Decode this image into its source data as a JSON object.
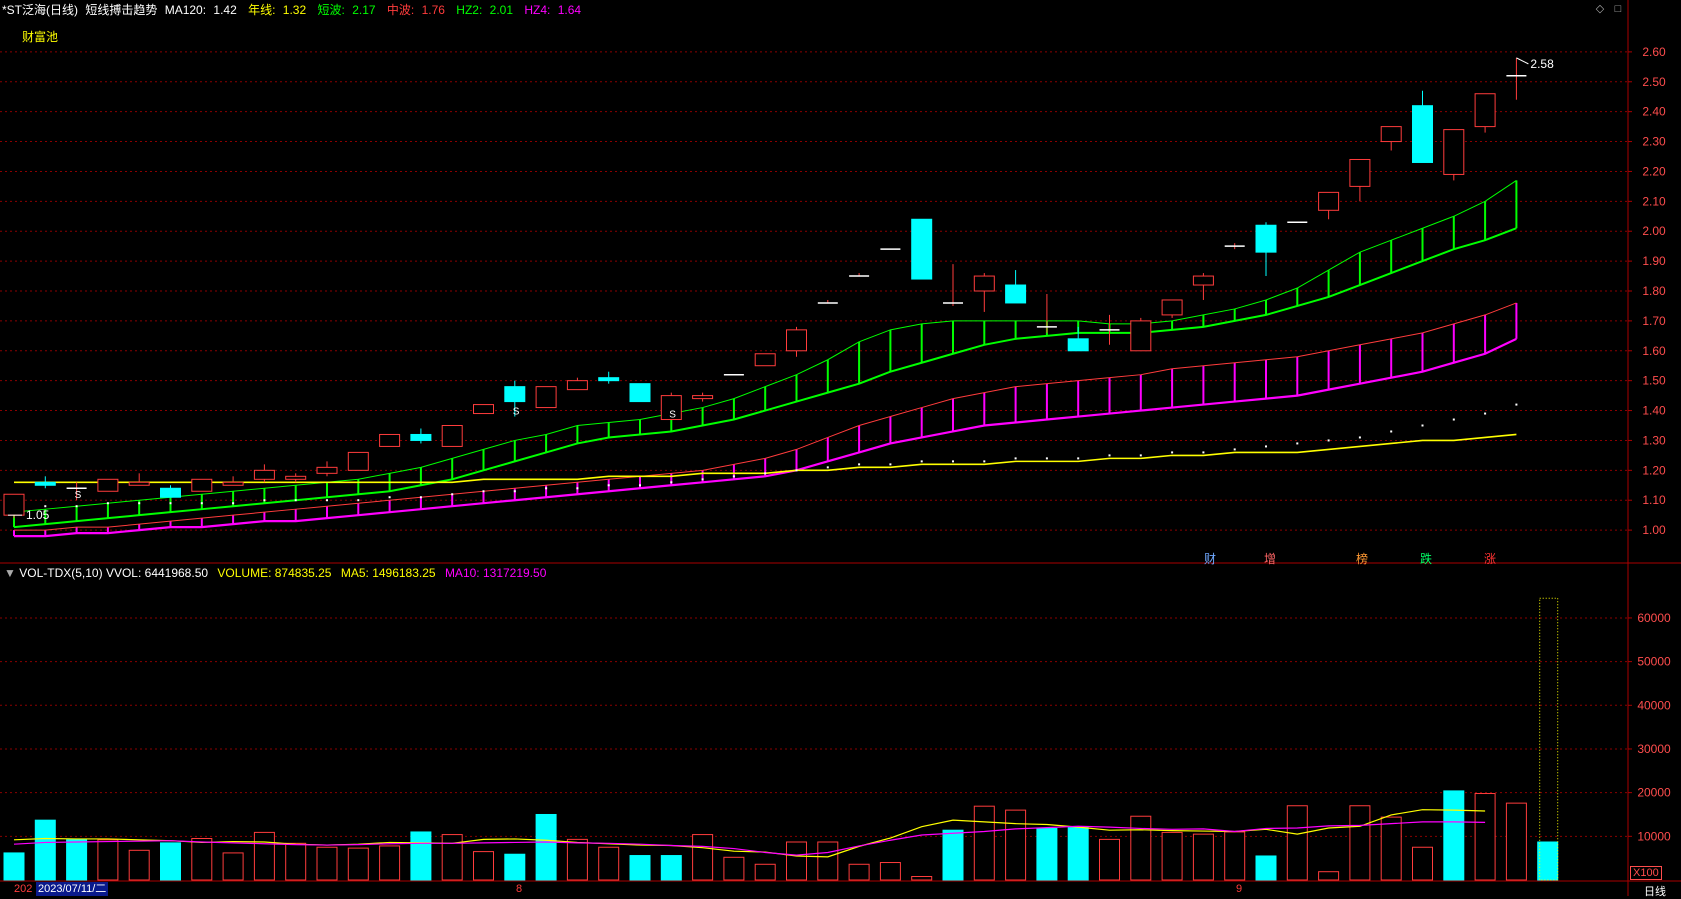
{
  "header": {
    "symbol": "*ST泛海(日线)",
    "indicator_name": "短线搏击趋势",
    "ma120_label": "MA120:",
    "ma120_value": "1.42",
    "year_label": "年线:",
    "year_value": "1.32",
    "short_label": "短波:",
    "short_value": "2.17",
    "mid_label": "中波:",
    "mid_value": "1.76",
    "hz2_label": "HZ2:",
    "hz2_value": "2.01",
    "hz4_label": "HZ4:",
    "hz4_value": "1.64",
    "pool_label": "财富池"
  },
  "volume_header": {
    "name": "VOL-TDX(5,10)",
    "vvol_label": "VVOL:",
    "vvol_value": "6441968.50",
    "volume_label": "VOLUME:",
    "volume_value": "874835.25",
    "ma5_label": "MA5:",
    "ma5_value": "1496183.25",
    "ma10_label": "MA10:",
    "ma10_value": "1317219.50"
  },
  "footer": {
    "date_prefix": "202",
    "date": "2023/07/11/二",
    "month_aug": "8",
    "month_sep": "9",
    "period": "日线",
    "scale": "X100"
  },
  "signals": [
    "财",
    "增",
    "榜",
    "跌",
    "涨"
  ],
  "annotations": {
    "high_label": "2.58",
    "low_label": "1.05",
    "marker_s": "S"
  },
  "colors": {
    "up": "#ff3c3c",
    "down": "#00ffff",
    "green_band": "#00ff00",
    "magenta_band": "#ff00ff",
    "yellow": "#ffff00",
    "grid": "#8b0000",
    "axis_text": "#ff4d4d"
  },
  "chart_data": [
    {
      "type": "candlestick",
      "title": "短线搏击趋势",
      "ylim": [
        0.9,
        2.7
      ],
      "yticks": [
        1.0,
        1.1,
        1.2,
        1.3,
        1.4,
        1.5,
        1.6,
        1.7,
        1.8,
        1.9,
        2.0,
        2.1,
        2.2,
        2.3,
        2.4,
        2.5,
        2.6
      ],
      "candles": [
        {
          "o": 1.05,
          "h": 1.12,
          "l": 1.04,
          "c": 1.12
        },
        {
          "o": 1.16,
          "h": 1.18,
          "l": 1.14,
          "c": 1.15
        },
        {
          "o": 1.14,
          "h": 1.16,
          "l": 1.1,
          "c": 1.14
        },
        {
          "o": 1.13,
          "h": 1.17,
          "l": 1.13,
          "c": 1.17
        },
        {
          "o": 1.15,
          "h": 1.19,
          "l": 1.15,
          "c": 1.16
        },
        {
          "o": 1.14,
          "h": 1.15,
          "l": 1.11,
          "c": 1.11
        },
        {
          "o": 1.13,
          "h": 1.17,
          "l": 1.13,
          "c": 1.17
        },
        {
          "o": 1.15,
          "h": 1.18,
          "l": 1.15,
          "c": 1.16
        },
        {
          "o": 1.17,
          "h": 1.22,
          "l": 1.16,
          "c": 1.2
        },
        {
          "o": 1.17,
          "h": 1.19,
          "l": 1.16,
          "c": 1.18
        },
        {
          "o": 1.19,
          "h": 1.23,
          "l": 1.18,
          "c": 1.21
        },
        {
          "o": 1.2,
          "h": 1.26,
          "l": 1.2,
          "c": 1.26
        },
        {
          "o": 1.28,
          "h": 1.32,
          "l": 1.28,
          "c": 1.32
        },
        {
          "o": 1.32,
          "h": 1.34,
          "l": 1.29,
          "c": 1.3
        },
        {
          "o": 1.28,
          "h": 1.35,
          "l": 1.28,
          "c": 1.35
        },
        {
          "o": 1.39,
          "h": 1.42,
          "l": 1.39,
          "c": 1.42
        },
        {
          "o": 1.48,
          "h": 1.5,
          "l": 1.38,
          "c": 1.43
        },
        {
          "o": 1.41,
          "h": 1.48,
          "l": 1.41,
          "c": 1.48
        },
        {
          "o": 1.47,
          "h": 1.51,
          "l": 1.47,
          "c": 1.5
        },
        {
          "o": 1.51,
          "h": 1.53,
          "l": 1.49,
          "c": 1.5
        },
        {
          "o": 1.49,
          "h": 1.49,
          "l": 1.43,
          "c": 1.43
        },
        {
          "o": 1.37,
          "h": 1.46,
          "l": 1.37,
          "c": 1.45
        },
        {
          "o": 1.44,
          "h": 1.46,
          "l": 1.43,
          "c": 1.45
        },
        {
          "o": 1.52,
          "h": 1.52,
          "l": 1.52,
          "c": 1.52
        },
        {
          "o": 1.55,
          "h": 1.59,
          "l": 1.55,
          "c": 1.59
        },
        {
          "o": 1.6,
          "h": 1.68,
          "l": 1.58,
          "c": 1.67
        },
        {
          "o": 1.76,
          "h": 1.77,
          "l": 1.76,
          "c": 1.76
        },
        {
          "o": 1.85,
          "h": 1.86,
          "l": 1.85,
          "c": 1.85
        },
        {
          "o": 1.94,
          "h": 1.94,
          "l": 1.94,
          "c": 1.94
        },
        {
          "o": 2.04,
          "h": 2.04,
          "l": 1.84,
          "c": 1.84
        },
        {
          "o": 1.76,
          "h": 1.89,
          "l": 1.75,
          "c": 1.76
        },
        {
          "o": 1.8,
          "h": 1.86,
          "l": 1.73,
          "c": 1.85
        },
        {
          "o": 1.82,
          "h": 1.87,
          "l": 1.76,
          "c": 1.76
        },
        {
          "o": 1.68,
          "h": 1.79,
          "l": 1.66,
          "c": 1.68
        },
        {
          "o": 1.64,
          "h": 1.68,
          "l": 1.6,
          "c": 1.6
        },
        {
          "o": 1.67,
          "h": 1.72,
          "l": 1.62,
          "c": 1.67
        },
        {
          "o": 1.6,
          "h": 1.71,
          "l": 1.6,
          "c": 1.7
        },
        {
          "o": 1.72,
          "h": 1.77,
          "l": 1.71,
          "c": 1.77
        },
        {
          "o": 1.82,
          "h": 1.86,
          "l": 1.77,
          "c": 1.85
        },
        {
          "o": 1.95,
          "h": 1.96,
          "l": 1.94,
          "c": 1.95
        },
        {
          "o": 2.02,
          "h": 2.03,
          "l": 1.85,
          "c": 1.93
        },
        {
          "o": 2.03,
          "h": 2.03,
          "l": 2.03,
          "c": 2.03
        },
        {
          "o": 2.07,
          "h": 2.13,
          "l": 2.04,
          "c": 2.13
        },
        {
          "o": 2.15,
          "h": 2.24,
          "l": 2.1,
          "c": 2.24
        },
        {
          "o": 2.3,
          "h": 2.35,
          "l": 2.27,
          "c": 2.35
        },
        {
          "o": 2.42,
          "h": 2.47,
          "l": 2.23,
          "c": 2.23
        },
        {
          "o": 2.19,
          "h": 2.34,
          "l": 2.17,
          "c": 2.34
        },
        {
          "o": 2.35,
          "h": 2.46,
          "l": 2.33,
          "c": 2.46
        },
        {
          "o": 2.52,
          "h": 2.58,
          "l": 2.44,
          "c": 2.52
        }
      ],
      "year_line": [
        1.16,
        1.16,
        1.16,
        1.16,
        1.16,
        1.16,
        1.16,
        1.16,
        1.16,
        1.16,
        1.16,
        1.16,
        1.16,
        1.16,
        1.16,
        1.17,
        1.17,
        1.17,
        1.17,
        1.18,
        1.18,
        1.18,
        1.19,
        1.19,
        1.19,
        1.2,
        1.2,
        1.21,
        1.21,
        1.22,
        1.22,
        1.22,
        1.23,
        1.23,
        1.23,
        1.24,
        1.24,
        1.25,
        1.25,
        1.26,
        1.26,
        1.26,
        1.27,
        1.28,
        1.29,
        1.3,
        1.3,
        1.31,
        1.32
      ],
      "ma120": [
        1.08,
        1.08,
        1.08,
        1.09,
        1.09,
        1.09,
        1.09,
        1.09,
        1.1,
        1.1,
        1.1,
        1.1,
        1.11,
        1.11,
        1.12,
        1.13,
        1.13,
        1.14,
        1.14,
        1.15,
        1.15,
        1.16,
        1.17,
        1.18,
        1.19,
        1.2,
        1.21,
        1.22,
        1.22,
        1.23,
        1.23,
        1.23,
        1.24,
        1.24,
        1.24,
        1.25,
        1.25,
        1.26,
        1.26,
        1.27,
        1.28,
        1.29,
        1.3,
        1.31,
        1.33,
        1.35,
        1.37,
        1.39,
        1.42
      ],
      "green_upper": [
        1.06,
        1.07,
        1.08,
        1.09,
        1.1,
        1.11,
        1.12,
        1.13,
        1.14,
        1.15,
        1.16,
        1.17,
        1.19,
        1.21,
        1.24,
        1.27,
        1.3,
        1.32,
        1.35,
        1.36,
        1.37,
        1.39,
        1.41,
        1.44,
        1.48,
        1.52,
        1.57,
        1.63,
        1.67,
        1.69,
        1.7,
        1.7,
        1.7,
        1.7,
        1.7,
        1.69,
        1.69,
        1.7,
        1.72,
        1.74,
        1.77,
        1.81,
        1.87,
        1.93,
        1.97,
        2.01,
        2.05,
        2.1,
        2.17
      ],
      "green_lower": [
        1.01,
        1.02,
        1.03,
        1.04,
        1.05,
        1.06,
        1.07,
        1.08,
        1.09,
        1.1,
        1.11,
        1.12,
        1.13,
        1.15,
        1.17,
        1.2,
        1.23,
        1.26,
        1.29,
        1.31,
        1.32,
        1.33,
        1.35,
        1.37,
        1.4,
        1.43,
        1.46,
        1.49,
        1.53,
        1.56,
        1.59,
        1.62,
        1.64,
        1.65,
        1.66,
        1.66,
        1.66,
        1.67,
        1.68,
        1.7,
        1.72,
        1.75,
        1.78,
        1.82,
        1.86,
        1.9,
        1.94,
        1.97,
        2.01
      ],
      "mag_upper": [
        1.0,
        1.0,
        1.01,
        1.01,
        1.02,
        1.03,
        1.04,
        1.05,
        1.06,
        1.07,
        1.08,
        1.09,
        1.1,
        1.11,
        1.12,
        1.13,
        1.14,
        1.15,
        1.16,
        1.17,
        1.18,
        1.19,
        1.2,
        1.22,
        1.24,
        1.27,
        1.31,
        1.35,
        1.38,
        1.41,
        1.44,
        1.46,
        1.48,
        1.49,
        1.5,
        1.51,
        1.52,
        1.54,
        1.55,
        1.56,
        1.57,
        1.58,
        1.6,
        1.62,
        1.64,
        1.66,
        1.69,
        1.72,
        1.76
      ],
      "mag_lower": [
        0.98,
        0.98,
        0.99,
        0.99,
        1.0,
        1.01,
        1.01,
        1.02,
        1.03,
        1.03,
        1.04,
        1.05,
        1.06,
        1.07,
        1.08,
        1.09,
        1.1,
        1.11,
        1.12,
        1.13,
        1.14,
        1.15,
        1.16,
        1.17,
        1.18,
        1.2,
        1.23,
        1.26,
        1.29,
        1.31,
        1.33,
        1.35,
        1.36,
        1.37,
        1.38,
        1.39,
        1.4,
        1.41,
        1.42,
        1.43,
        1.44,
        1.45,
        1.47,
        1.49,
        1.51,
        1.53,
        1.56,
        1.59,
        1.64
      ]
    },
    {
      "type": "bar",
      "title": "VOL-TDX(5,10)",
      "ylim": [
        0,
        68000
      ],
      "yticks": [
        10000,
        20000,
        30000,
        40000,
        50000,
        60000
      ],
      "unit_label": "X100",
      "volumes": [
        6200,
        13700,
        9200,
        9200,
        6800,
        8500,
        9500,
        6200,
        10900,
        8400,
        7500,
        7300,
        7800,
        11000,
        10400,
        6500,
        5900,
        15000,
        9300,
        7500,
        5600,
        5600,
        10400,
        5200,
        3600,
        8700,
        8700,
        3600,
        4000,
        800,
        11400,
        16900,
        16000,
        11800,
        12000,
        9300,
        14600,
        10900,
        10500,
        11000,
        5500,
        17000,
        1900,
        17000,
        14400,
        7500,
        20400,
        19800,
        17600,
        8700
      ],
      "vol_up": [
        false,
        false,
        false,
        true,
        true,
        false,
        true,
        true,
        true,
        true,
        true,
        true,
        true,
        false,
        true,
        true,
        false,
        false,
        true,
        true,
        false,
        false,
        true,
        true,
        true,
        true,
        true,
        true,
        true,
        true,
        false,
        true,
        true,
        false,
        false,
        true,
        true,
        true,
        true,
        true,
        false,
        true,
        true,
        true,
        true,
        true,
        false,
        true,
        true,
        false
      ],
      "ma5": [
        9200,
        9500,
        9400,
        9400,
        9200,
        9000,
        8600,
        8800,
        8700,
        8200,
        8000,
        8200,
        8600,
        8500,
        8400,
        9300,
        9400,
        9100,
        8600,
        8300,
        8000,
        7900,
        7400,
        6600,
        6400,
        5500,
        5300,
        7700,
        9600,
        12200,
        13700,
        13300,
        12900,
        12700,
        12100,
        11400,
        11500,
        11300,
        11200,
        11100,
        11600,
        10500,
        11900,
        12300,
        14900,
        16100,
        16000,
        15800
      ],
      "ma10": [
        8200,
        8600,
        8700,
        8800,
        8900,
        9000,
        8700,
        8500,
        8300,
        8100,
        8000,
        8100,
        8300,
        8400,
        8400,
        8500,
        8600,
        8700,
        8500,
        8400,
        8200,
        7900,
        7700,
        7200,
        6300,
        5700,
        6300,
        7800,
        9100,
        10300,
        10700,
        11100,
        11700,
        12000,
        12300,
        12100,
        11800,
        11600,
        11700,
        11100,
        11800,
        11900,
        12400,
        12500,
        12900,
        13300,
        13300,
        13200
      ]
    }
  ]
}
